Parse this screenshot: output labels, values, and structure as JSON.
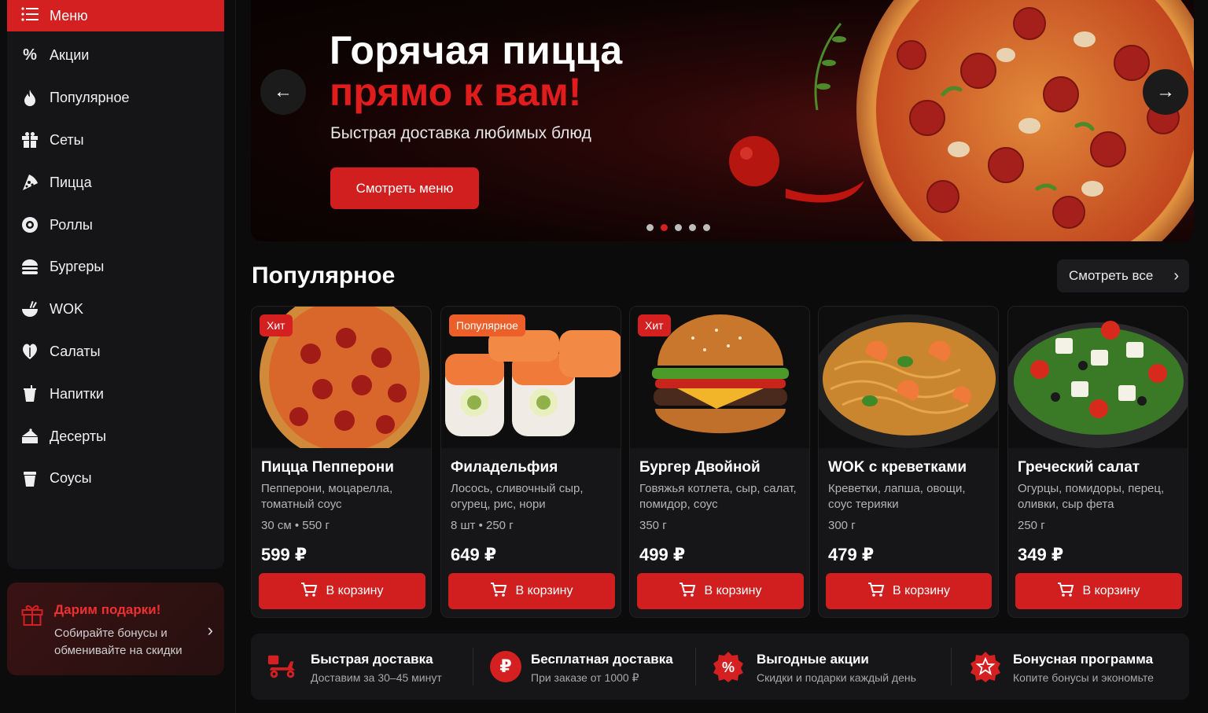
{
  "sidebar": {
    "menu_label": "Меню",
    "items": [
      {
        "label": "Акции",
        "icon": "percent-icon"
      },
      {
        "label": "Популярное",
        "icon": "fire-icon"
      },
      {
        "label": "Сеты",
        "icon": "gift-box-icon"
      },
      {
        "label": "Пицца",
        "icon": "pizza-slice-icon"
      },
      {
        "label": "Роллы",
        "icon": "roll-icon"
      },
      {
        "label": "Бургеры",
        "icon": "burger-icon"
      },
      {
        "label": "WOK",
        "icon": "wok-bowl-icon"
      },
      {
        "label": "Салаты",
        "icon": "salad-icon"
      },
      {
        "label": "Напитки",
        "icon": "drink-cup-icon"
      },
      {
        "label": "Десерты",
        "icon": "cake-icon"
      },
      {
        "label": "Соусы",
        "icon": "sauce-cup-icon"
      }
    ],
    "promo": {
      "title": "Дарим подарки!",
      "text": "Собирайте бонусы и обменивайте на скидки"
    }
  },
  "banner": {
    "title_line1": "Горячая пицца",
    "title_line2": "прямо к вам!",
    "subtitle": "Быстрая доставка любимых блюд",
    "button_label": "Смотреть меню",
    "slides_total": 5,
    "active_slide": 2
  },
  "popular": {
    "title": "Популярное",
    "see_all_label": "Смотреть все",
    "add_to_cart_label": "В корзину",
    "products": [
      {
        "badge": "Хит",
        "name": "Пицца Пепперони",
        "desc": "Пепперони, моцарелла, томатный соус",
        "meta": "30 см • 550 г",
        "price": "599 ₽"
      },
      {
        "badge": "Популярное",
        "name": "Филадельфия",
        "desc": "Лосось, сливочный сыр, огурец, рис, нори",
        "meta": "8 шт • 250 г",
        "price": "649 ₽"
      },
      {
        "badge": "Хит",
        "name": "Бургер Двойной",
        "desc": "Говяжья котлета, сыр, салат, помидор, соус",
        "meta": "350 г",
        "price": "499 ₽"
      },
      {
        "badge": "",
        "name": "WOK с креветками",
        "desc": "Креветки, лапша, овощи, соус терияки",
        "meta": "300 г",
        "price": "479 ₽"
      },
      {
        "badge": "",
        "name": "Греческий салат",
        "desc": "Огурцы, помидоры, перец, оливки, сыр фета",
        "meta": "250 г",
        "price": "349 ₽"
      }
    ]
  },
  "features": [
    {
      "title": "Быстрая доставка",
      "sub": "Доставим за 30–45 минут",
      "icon": "scooter-icon"
    },
    {
      "title": "Бесплатная доставка",
      "sub": "При заказе от 1000 ₽",
      "icon": "ruble-icon"
    },
    {
      "title": "Выгодные акции",
      "sub": "Скидки и подарки каждый день",
      "icon": "discount-badge-icon"
    },
    {
      "title": "Бонусная программа",
      "sub": "Копите бонусы и экономьте",
      "icon": "star-badge-icon"
    }
  ],
  "colors": {
    "accent": "#d42020",
    "orange_badge": "#ec5f28",
    "background": "#0b0b0c",
    "card": "#161618"
  }
}
